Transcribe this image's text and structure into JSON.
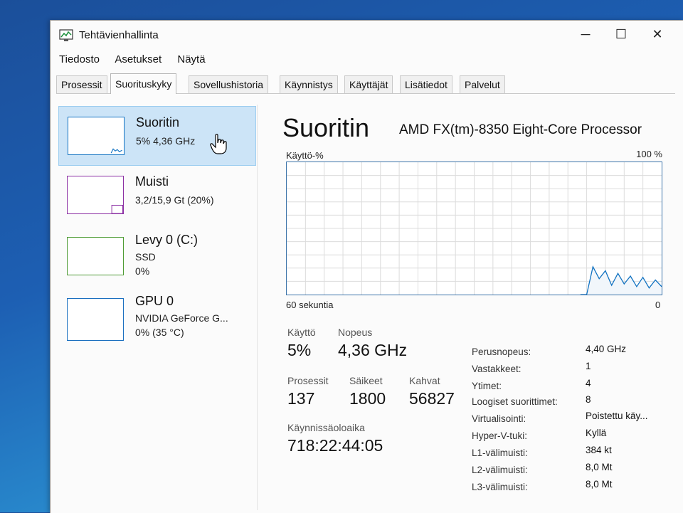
{
  "window": {
    "title": "Tehtävienhallinta",
    "controls": {
      "minimize": "─",
      "maximize": "☐",
      "close": "✕"
    }
  },
  "menu": [
    "Tiedosto",
    "Asetukset",
    "Näytä"
  ],
  "tabs": [
    "Prosessit",
    "Suorituskyky",
    "Sovellushistoria",
    "Käynnistys",
    "Käyttäjät",
    "Lisätiedot",
    "Palvelut"
  ],
  "active_tab": "Suorituskyky",
  "resources": [
    {
      "name": "Suoritin",
      "line1": "5% 4,36 GHz",
      "line2": ""
    },
    {
      "name": "Muisti",
      "line1": "3,2/15,9 Gt (20%)",
      "line2": ""
    },
    {
      "name": "Levy 0 (C:)",
      "line1": "SSD",
      "line2": "0%"
    },
    {
      "name": "GPU 0",
      "line1": "NVIDIA GeForce G...",
      "line2": "0% (35 °C)"
    }
  ],
  "detail": {
    "title": "Suoritin",
    "processor": "AMD FX(tm)-8350 Eight-Core Processor",
    "graph": {
      "y_label": "Käyttö-%",
      "y_max_label": "100 %",
      "x_label": "60 sekuntia",
      "x_min_label": "0",
      "recent_usage_percent": [
        0,
        0,
        21,
        12,
        18,
        7,
        16,
        8,
        14,
        6,
        13,
        5,
        11,
        6
      ]
    },
    "stats": {
      "usage_label": "Käyttö",
      "usage_value": "5%",
      "speed_label": "Nopeus",
      "speed_value": "4,36 GHz",
      "processes_label": "Prosessit",
      "processes_value": "137",
      "threads_label": "Säikeet",
      "threads_value": "1800",
      "handles_label": "Kahvat",
      "handles_value": "56827",
      "uptime_label": "Käynnissäoloaika",
      "uptime_value": "718:22:44:05"
    },
    "info": [
      {
        "key": "Perusnopeus:",
        "value": "4,40 GHz"
      },
      {
        "key": "Vastakkeet:",
        "value": "1"
      },
      {
        "key": "Ytimet:",
        "value": "4"
      },
      {
        "key": "Loogiset suorittimet:",
        "value": "8"
      },
      {
        "key": "Virtualisointi:",
        "value": "Poistettu käy..."
      },
      {
        "key": "Hyper-V-tuki:",
        "value": "Kyllä"
      },
      {
        "key": "L1-välimuisti:",
        "value": "384 kt"
      },
      {
        "key": "L2-välimuisti:",
        "value": "8,0 Mt"
      },
      {
        "key": "L3-välimuisti:",
        "value": "8,0 Mt"
      }
    ]
  },
  "colors": {
    "cpu_accent": "#1172c1",
    "memory_accent": "#8b2ea3",
    "disk_accent": "#4d9a33",
    "gpu_accent": "#1a6fbf",
    "selected_bg": "#cce4f7"
  },
  "icons": {
    "app": "task-manager-icon",
    "cursor": "hand-pointer-icon"
  }
}
